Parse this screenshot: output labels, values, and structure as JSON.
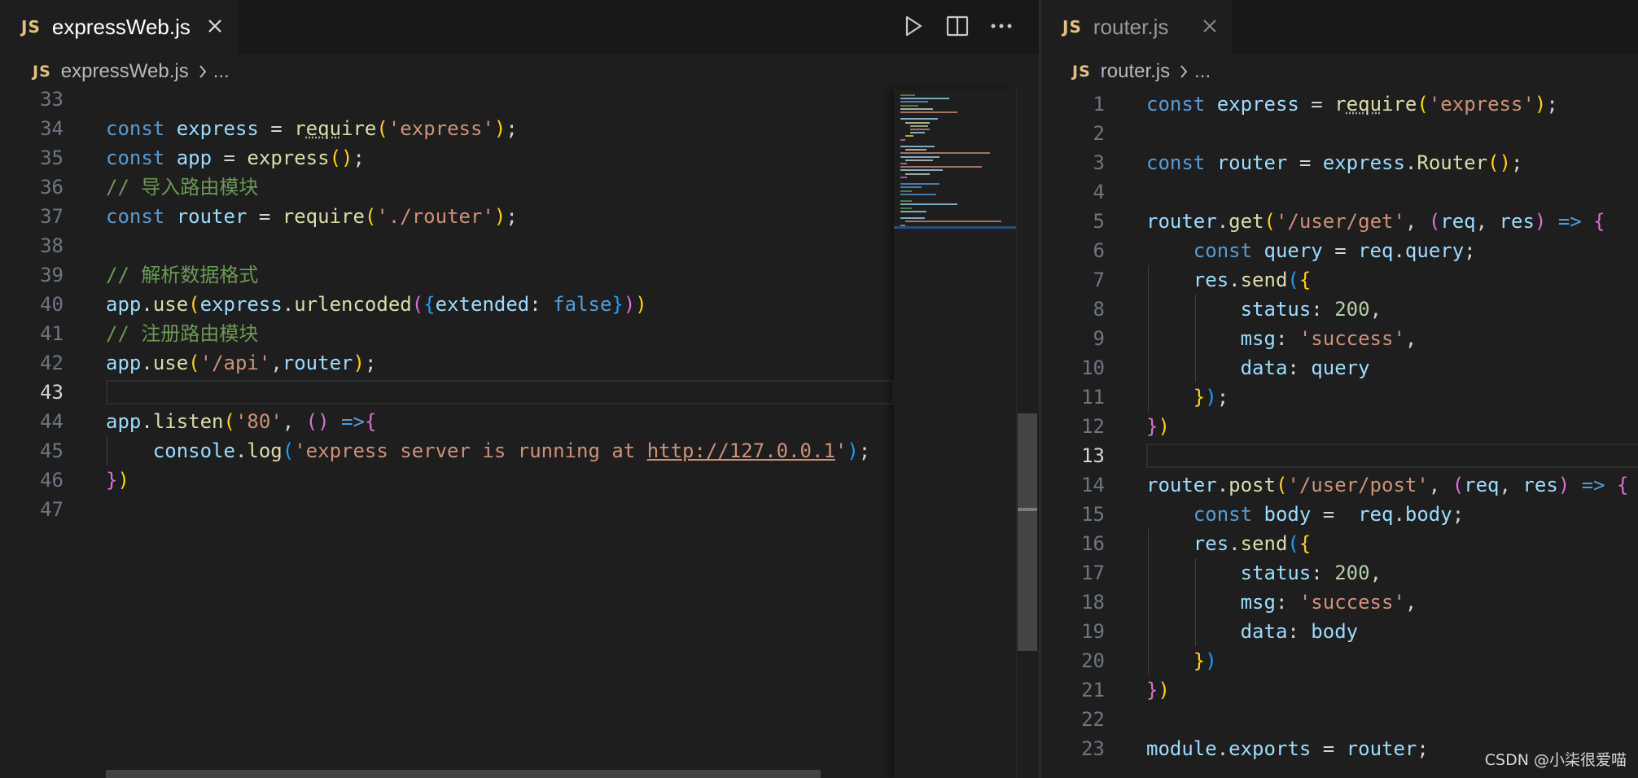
{
  "colors": {
    "keyword": "#569cd6",
    "variable": "#9cdcfe",
    "function": "#dcdcaa",
    "string": "#ce9178",
    "comment": "#6a9955",
    "number": "#b5cea8",
    "bracket1": "#ffd700",
    "bracket2": "#da70d6",
    "bracket3": "#179fff",
    "js_badge": "#e5c07b",
    "background": "#1e1e1e"
  },
  "left_editor": {
    "tab_label": "expressWeb.js",
    "tab_icon": "js-file-icon",
    "js_badge": "JS",
    "breadcrumb": {
      "file": "expressWeb.js",
      "more": "..."
    },
    "actions": [
      "run-icon",
      "split-editor-icon",
      "more-actions-icon"
    ],
    "current_line": 43,
    "lines": [
      {
        "n": "33",
        "tokens": []
      },
      {
        "n": "34",
        "tokens": [
          {
            "t": "const ",
            "c": "kw"
          },
          {
            "t": "express",
            "c": "var"
          },
          {
            "t": " = ",
            "c": "op"
          },
          {
            "t": "r",
            "c": "fn"
          },
          {
            "t": "equ",
            "c": "fn dot"
          },
          {
            "t": "ire",
            "c": "fn"
          },
          {
            "t": "(",
            "c": "p1"
          },
          {
            "t": "'express'",
            "c": "str"
          },
          {
            "t": ")",
            "c": "p1"
          },
          {
            "t": ";",
            "c": "op"
          }
        ]
      },
      {
        "n": "35",
        "tokens": [
          {
            "t": "const ",
            "c": "kw"
          },
          {
            "t": "app",
            "c": "var"
          },
          {
            "t": " = ",
            "c": "op"
          },
          {
            "t": "express",
            "c": "fn"
          },
          {
            "t": "()",
            "c": "p1"
          },
          {
            "t": ";",
            "c": "op"
          }
        ]
      },
      {
        "n": "36",
        "tokens": [
          {
            "t": "// 导入路由模块",
            "c": "com"
          }
        ]
      },
      {
        "n": "37",
        "tokens": [
          {
            "t": "const ",
            "c": "kw"
          },
          {
            "t": "router",
            "c": "var"
          },
          {
            "t": " = ",
            "c": "op"
          },
          {
            "t": "require",
            "c": "fn"
          },
          {
            "t": "(",
            "c": "p1"
          },
          {
            "t": "'./router'",
            "c": "str"
          },
          {
            "t": ")",
            "c": "p1"
          },
          {
            "t": ";",
            "c": "op"
          }
        ]
      },
      {
        "n": "38",
        "tokens": []
      },
      {
        "n": "39",
        "tokens": [
          {
            "t": "// 解析数据格式",
            "c": "com"
          }
        ]
      },
      {
        "n": "40",
        "tokens": [
          {
            "t": "app",
            "c": "var"
          },
          {
            "t": ".",
            "c": "op"
          },
          {
            "t": "use",
            "c": "fn"
          },
          {
            "t": "(",
            "c": "p1"
          },
          {
            "t": "express",
            "c": "var"
          },
          {
            "t": ".",
            "c": "op"
          },
          {
            "t": "urlencoded",
            "c": "fn"
          },
          {
            "t": "(",
            "c": "p2"
          },
          {
            "t": "{",
            "c": "p3"
          },
          {
            "t": "extended",
            "c": "var"
          },
          {
            "t": ": ",
            "c": "op"
          },
          {
            "t": "false",
            "c": "kw"
          },
          {
            "t": "}",
            "c": "p3"
          },
          {
            "t": ")",
            "c": "p2"
          },
          {
            "t": ")",
            "c": "p1"
          }
        ]
      },
      {
        "n": "41",
        "tokens": [
          {
            "t": "// 注册路由模块",
            "c": "com"
          }
        ]
      },
      {
        "n": "42",
        "tokens": [
          {
            "t": "app",
            "c": "var"
          },
          {
            "t": ".",
            "c": "op"
          },
          {
            "t": "use",
            "c": "fn"
          },
          {
            "t": "(",
            "c": "p1"
          },
          {
            "t": "'/api'",
            "c": "str"
          },
          {
            "t": ",",
            "c": "op"
          },
          {
            "t": "router",
            "c": "var"
          },
          {
            "t": ")",
            "c": "p1"
          },
          {
            "t": ";",
            "c": "op"
          }
        ]
      },
      {
        "n": "43",
        "tokens": []
      },
      {
        "n": "44",
        "tokens": [
          {
            "t": "app",
            "c": "var"
          },
          {
            "t": ".",
            "c": "op"
          },
          {
            "t": "listen",
            "c": "fn"
          },
          {
            "t": "(",
            "c": "p1"
          },
          {
            "t": "'80'",
            "c": "str"
          },
          {
            "t": ", ",
            "c": "op"
          },
          {
            "t": "()",
            "c": "p2"
          },
          {
            "t": " ",
            "c": "op"
          },
          {
            "t": "=>",
            "c": "kw"
          },
          {
            "t": "{",
            "c": "p2"
          }
        ]
      },
      {
        "n": "45",
        "tokens": [
          {
            "t": "    ",
            "c": "op"
          },
          {
            "t": "console",
            "c": "var"
          },
          {
            "t": ".",
            "c": "op"
          },
          {
            "t": "log",
            "c": "fn"
          },
          {
            "t": "(",
            "c": "p3"
          },
          {
            "t": "'express server is running at ",
            "c": "str"
          },
          {
            "t": "http://127.0.0.1",
            "c": "url"
          },
          {
            "t": "'",
            "c": "str"
          },
          {
            "t": ")",
            "c": "p3"
          },
          {
            "t": ";",
            "c": "op"
          }
        ]
      },
      {
        "n": "46",
        "tokens": [
          {
            "t": "}",
            "c": "p2"
          },
          {
            "t": ")",
            "c": "p1"
          }
        ]
      },
      {
        "n": "47",
        "tokens": []
      }
    ]
  },
  "right_editor": {
    "tab_label": "router.js",
    "tab_icon": "js-file-icon",
    "js_badge": "JS",
    "breadcrumb": {
      "file": "router.js",
      "more": "..."
    },
    "current_line": 13,
    "lines": [
      {
        "n": "1",
        "tokens": [
          {
            "t": "const ",
            "c": "kw"
          },
          {
            "t": "express",
            "c": "var"
          },
          {
            "t": " = ",
            "c": "op"
          },
          {
            "t": "r",
            "c": "fn"
          },
          {
            "t": "equ",
            "c": "fn dot"
          },
          {
            "t": "ire",
            "c": "fn"
          },
          {
            "t": "(",
            "c": "p1"
          },
          {
            "t": "'express'",
            "c": "str"
          },
          {
            "t": ")",
            "c": "p1"
          },
          {
            "t": ";",
            "c": "op"
          }
        ]
      },
      {
        "n": "2",
        "tokens": []
      },
      {
        "n": "3",
        "tokens": [
          {
            "t": "const ",
            "c": "kw"
          },
          {
            "t": "router",
            "c": "var"
          },
          {
            "t": " = ",
            "c": "op"
          },
          {
            "t": "express",
            "c": "var"
          },
          {
            "t": ".",
            "c": "op"
          },
          {
            "t": "Router",
            "c": "fn"
          },
          {
            "t": "()",
            "c": "p1"
          },
          {
            "t": ";",
            "c": "op"
          }
        ]
      },
      {
        "n": "4",
        "tokens": []
      },
      {
        "n": "5",
        "tokens": [
          {
            "t": "router",
            "c": "var"
          },
          {
            "t": ".",
            "c": "op"
          },
          {
            "t": "get",
            "c": "fn"
          },
          {
            "t": "(",
            "c": "p1"
          },
          {
            "t": "'/user/get'",
            "c": "str"
          },
          {
            "t": ", ",
            "c": "op"
          },
          {
            "t": "(",
            "c": "p2"
          },
          {
            "t": "req",
            "c": "var"
          },
          {
            "t": ", ",
            "c": "op"
          },
          {
            "t": "res",
            "c": "var"
          },
          {
            "t": ")",
            "c": "p2"
          },
          {
            "t": " ",
            "c": "op"
          },
          {
            "t": "=>",
            "c": "kw"
          },
          {
            "t": " ",
            "c": "op"
          },
          {
            "t": "{",
            "c": "p2"
          }
        ]
      },
      {
        "n": "6",
        "tokens": [
          {
            "t": "    ",
            "c": "op"
          },
          {
            "t": "const ",
            "c": "kw"
          },
          {
            "t": "query",
            "c": "var"
          },
          {
            "t": " = ",
            "c": "op"
          },
          {
            "t": "req",
            "c": "var"
          },
          {
            "t": ".",
            "c": "op"
          },
          {
            "t": "query",
            "c": "var"
          },
          {
            "t": ";",
            "c": "op"
          }
        ]
      },
      {
        "n": "7",
        "tokens": [
          {
            "t": "    ",
            "c": "op"
          },
          {
            "t": "res",
            "c": "var"
          },
          {
            "t": ".",
            "c": "op"
          },
          {
            "t": "send",
            "c": "fn"
          },
          {
            "t": "(",
            "c": "p3"
          },
          {
            "t": "{",
            "c": "p1"
          }
        ]
      },
      {
        "n": "8",
        "tokens": [
          {
            "t": "        ",
            "c": "op"
          },
          {
            "t": "status",
            "c": "var"
          },
          {
            "t": ": ",
            "c": "op"
          },
          {
            "t": "200",
            "c": "num"
          },
          {
            "t": ",",
            "c": "op"
          }
        ]
      },
      {
        "n": "9",
        "tokens": [
          {
            "t": "        ",
            "c": "op"
          },
          {
            "t": "msg",
            "c": "var"
          },
          {
            "t": ": ",
            "c": "op"
          },
          {
            "t": "'success'",
            "c": "str"
          },
          {
            "t": ",",
            "c": "op"
          }
        ]
      },
      {
        "n": "10",
        "tokens": [
          {
            "t": "        ",
            "c": "op"
          },
          {
            "t": "data",
            "c": "var"
          },
          {
            "t": ": ",
            "c": "op"
          },
          {
            "t": "query",
            "c": "var"
          }
        ]
      },
      {
        "n": "11",
        "tokens": [
          {
            "t": "    ",
            "c": "op"
          },
          {
            "t": "}",
            "c": "p1"
          },
          {
            "t": ")",
            "c": "p3"
          },
          {
            "t": ";",
            "c": "op"
          }
        ]
      },
      {
        "n": "12",
        "tokens": [
          {
            "t": "}",
            "c": "p2"
          },
          {
            "t": ")",
            "c": "p1"
          }
        ]
      },
      {
        "n": "13",
        "tokens": []
      },
      {
        "n": "14",
        "tokens": [
          {
            "t": "router",
            "c": "var"
          },
          {
            "t": ".",
            "c": "op"
          },
          {
            "t": "post",
            "c": "fn"
          },
          {
            "t": "(",
            "c": "p1"
          },
          {
            "t": "'/user/post'",
            "c": "str"
          },
          {
            "t": ", ",
            "c": "op"
          },
          {
            "t": "(",
            "c": "p2"
          },
          {
            "t": "req",
            "c": "var"
          },
          {
            "t": ", ",
            "c": "op"
          },
          {
            "t": "res",
            "c": "var"
          },
          {
            "t": ")",
            "c": "p2"
          },
          {
            "t": " ",
            "c": "op"
          },
          {
            "t": "=>",
            "c": "kw"
          },
          {
            "t": " ",
            "c": "op"
          },
          {
            "t": "{",
            "c": "p2"
          }
        ]
      },
      {
        "n": "15",
        "tokens": [
          {
            "t": "    ",
            "c": "op"
          },
          {
            "t": "const ",
            "c": "kw"
          },
          {
            "t": "body",
            "c": "var"
          },
          {
            "t": " =  ",
            "c": "op"
          },
          {
            "t": "req",
            "c": "var"
          },
          {
            "t": ".",
            "c": "op"
          },
          {
            "t": "body",
            "c": "var"
          },
          {
            "t": ";",
            "c": "op"
          }
        ]
      },
      {
        "n": "16",
        "tokens": [
          {
            "t": "    ",
            "c": "op"
          },
          {
            "t": "res",
            "c": "var"
          },
          {
            "t": ".",
            "c": "op"
          },
          {
            "t": "send",
            "c": "fn"
          },
          {
            "t": "(",
            "c": "p3"
          },
          {
            "t": "{",
            "c": "p1"
          }
        ]
      },
      {
        "n": "17",
        "tokens": [
          {
            "t": "        ",
            "c": "op"
          },
          {
            "t": "status",
            "c": "var"
          },
          {
            "t": ": ",
            "c": "op"
          },
          {
            "t": "200",
            "c": "num"
          },
          {
            "t": ",",
            "c": "op"
          }
        ]
      },
      {
        "n": "18",
        "tokens": [
          {
            "t": "        ",
            "c": "op"
          },
          {
            "t": "msg",
            "c": "var"
          },
          {
            "t": ": ",
            "c": "op"
          },
          {
            "t": "'success'",
            "c": "str"
          },
          {
            "t": ",",
            "c": "op"
          }
        ]
      },
      {
        "n": "19",
        "tokens": [
          {
            "t": "        ",
            "c": "op"
          },
          {
            "t": "data",
            "c": "var"
          },
          {
            "t": ": ",
            "c": "op"
          },
          {
            "t": "body",
            "c": "var"
          }
        ]
      },
      {
        "n": "20",
        "tokens": [
          {
            "t": "    ",
            "c": "op"
          },
          {
            "t": "}",
            "c": "p1"
          },
          {
            "t": ")",
            "c": "p3"
          }
        ]
      },
      {
        "n": "21",
        "tokens": [
          {
            "t": "}",
            "c": "p2"
          },
          {
            "t": ")",
            "c": "p1"
          }
        ]
      },
      {
        "n": "22",
        "tokens": []
      },
      {
        "n": "23",
        "tokens": [
          {
            "t": "module",
            "c": "var"
          },
          {
            "t": ".",
            "c": "op"
          },
          {
            "t": "exports",
            "c": "var"
          },
          {
            "t": " = ",
            "c": "op"
          },
          {
            "t": "router",
            "c": "var"
          },
          {
            "t": ";",
            "c": "op"
          }
        ]
      }
    ]
  },
  "watermark": "CSDN @小柒很爱喵"
}
